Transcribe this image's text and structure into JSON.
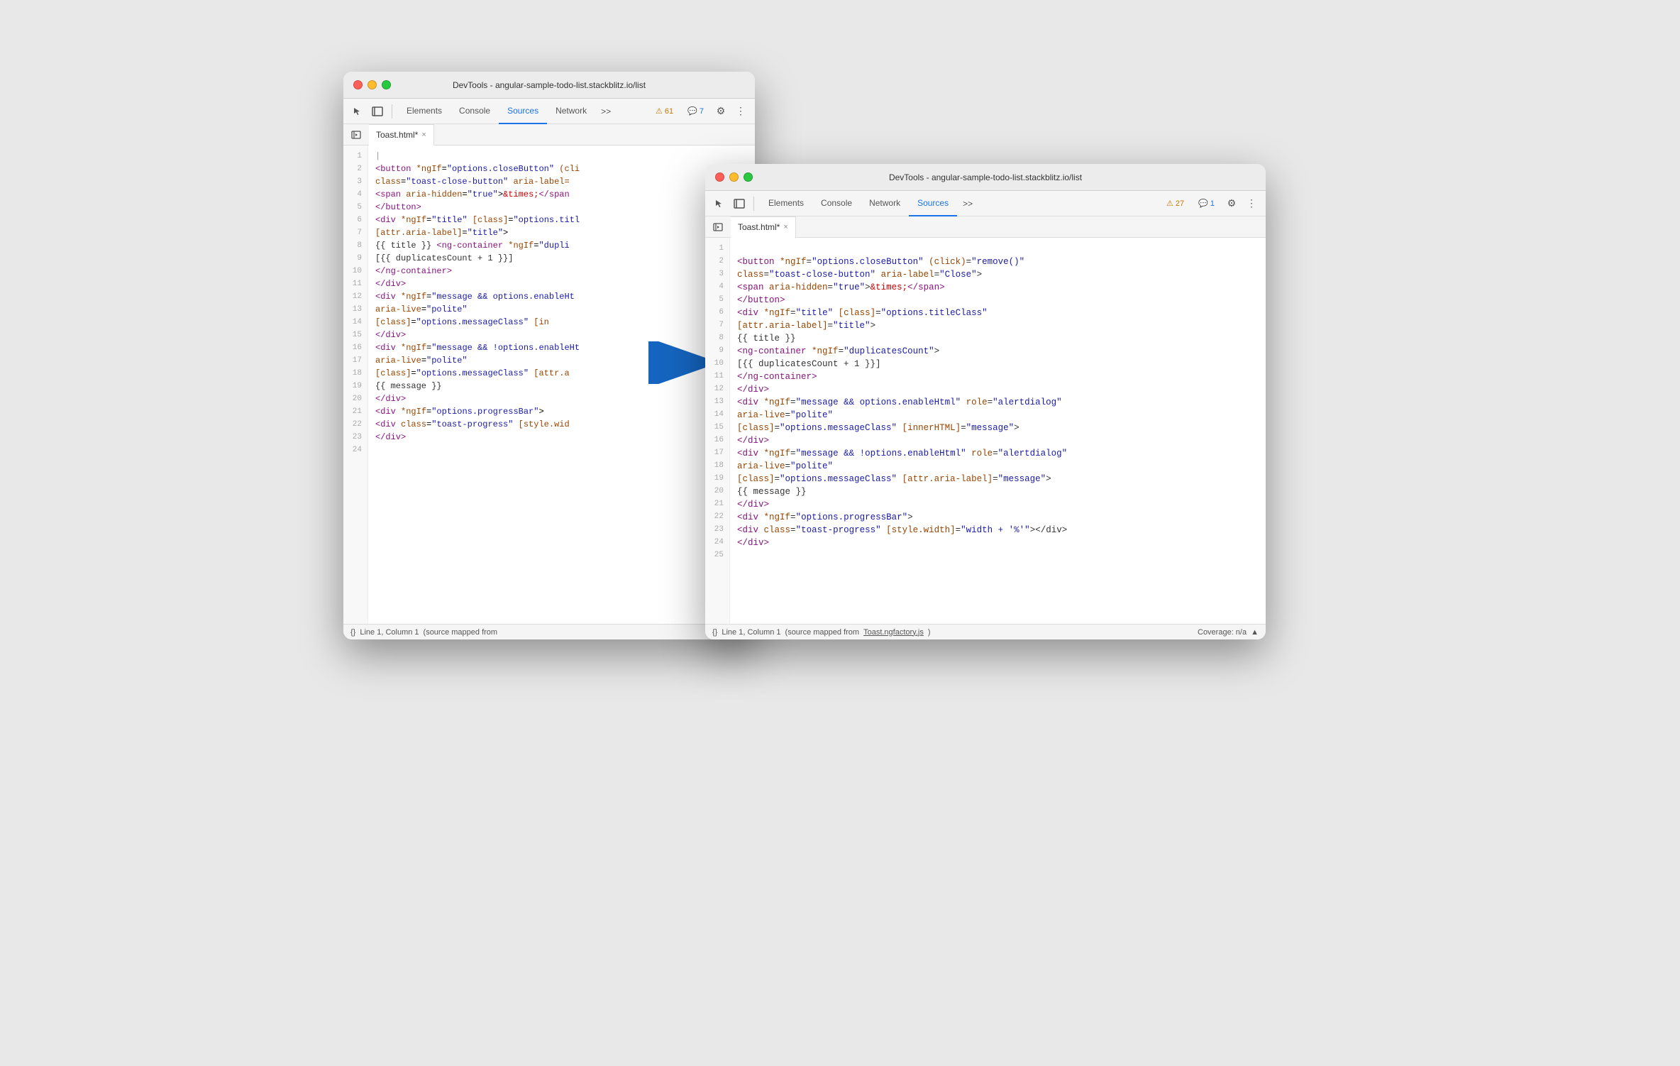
{
  "back_window": {
    "title": "DevTools - angular-sample-todo-list.stackblitz.io/list",
    "tabs": {
      "elements": "Elements",
      "console": "Console",
      "sources": "Sources",
      "network": "Network",
      "more": ">>"
    },
    "badges": {
      "warning_icon": "⚠",
      "warning_count": "61",
      "comment_icon": "💬",
      "comment_count": "7"
    },
    "file_tab": {
      "name": "Toast.html*",
      "close": "×"
    },
    "lines": [
      {
        "num": 1,
        "content": [
          {
            "t": " ",
            "c": ""
          }
        ]
      },
      {
        "num": 2,
        "content": [
          {
            "t": "  <button *ngIf=\"options.closeButton\" (cli",
            "c": "c-tag"
          }
        ]
      },
      {
        "num": 3,
        "content": [
          {
            "t": "      class=\"toast-close-button\" aria-label=",
            "c": "c-attr"
          }
        ]
      },
      {
        "num": 4,
        "content": [
          {
            "t": "    <span aria-hidden=\"true\">&times;</span>",
            "c": ""
          }
        ]
      },
      {
        "num": 5,
        "content": [
          {
            "t": "  </button>",
            "c": "c-tag"
          }
        ]
      },
      {
        "num": 6,
        "content": [
          {
            "t": "  <div *ngIf=\"title\" [class]=\"options.titl",
            "c": ""
          }
        ]
      },
      {
        "num": 7,
        "content": [
          {
            "t": "    [attr.aria-label]=\"title\">",
            "c": ""
          }
        ]
      },
      {
        "num": 8,
        "content": [
          {
            "t": "    {{ title }} <ng-container *ngIf=\"dupli",
            "c": ""
          }
        ]
      },
      {
        "num": 9,
        "content": [
          {
            "t": "      [{{ duplicatesCount + 1 }}]",
            "c": ""
          }
        ]
      },
      {
        "num": 10,
        "content": [
          {
            "t": "    </ng-container>",
            "c": "c-tag"
          }
        ]
      },
      {
        "num": 11,
        "content": [
          {
            "t": "  </div>",
            "c": "c-tag"
          }
        ]
      },
      {
        "num": 12,
        "content": [
          {
            "t": "  <div *ngIf=\"message && options.enableHt",
            "c": ""
          }
        ]
      },
      {
        "num": 13,
        "content": [
          {
            "t": "    aria-live=\"polite\"",
            "c": ""
          }
        ]
      },
      {
        "num": 14,
        "content": [
          {
            "t": "    [class]=\"options.messageClass\" [in",
            "c": ""
          }
        ]
      },
      {
        "num": 15,
        "content": [
          {
            "t": "  </div>",
            "c": "c-tag"
          }
        ]
      },
      {
        "num": 16,
        "content": [
          {
            "t": "  <div *ngIf=\"message && !options.enableHt",
            "c": ""
          }
        ]
      },
      {
        "num": 17,
        "content": [
          {
            "t": "    aria-live=\"polite\"",
            "c": ""
          }
        ]
      },
      {
        "num": 18,
        "content": [
          {
            "t": "    [class]=\"options.messageClass\" [attr.a",
            "c": ""
          }
        ]
      },
      {
        "num": 19,
        "content": [
          {
            "t": "    {{ message }}",
            "c": ""
          }
        ]
      },
      {
        "num": 20,
        "content": [
          {
            "t": "  </div>",
            "c": "c-tag"
          }
        ]
      },
      {
        "num": 21,
        "content": [
          {
            "t": "  <div *ngIf=\"options.progressBar\">",
            "c": ""
          }
        ]
      },
      {
        "num": 22,
        "content": [
          {
            "t": "    <div class=\"toast-progress\" [style.wid",
            "c": ""
          }
        ]
      },
      {
        "num": 23,
        "content": [
          {
            "t": "  </div>",
            "c": "c-tag"
          }
        ]
      },
      {
        "num": 24,
        "content": [
          {
            "t": "",
            "c": ""
          }
        ]
      }
    ],
    "status": {
      "left": "{}",
      "position": "Line 1, Column 1",
      "source": "(source mapped from "
    }
  },
  "front_window": {
    "title": "DevTools - angular-sample-todo-list.stackblitz.io/list",
    "tabs": {
      "elements": "Elements",
      "console": "Console",
      "network": "Network",
      "sources": "Sources",
      "more": ">>"
    },
    "badges": {
      "warning_icon": "⚠",
      "warning_count": "27",
      "comment_icon": "💬",
      "comment_count": "1"
    },
    "file_tab": {
      "name": "Toast.html*",
      "close": "×"
    },
    "lines": [
      {
        "num": 1,
        "html": ""
      },
      {
        "num": 2,
        "html": "<span class='c-tag'>&lt;button</span> <span class='c-brown'>*ngIf</span><span class='c-punct'>=</span><span class='c-str'>\"options.closeButton\"</span> <span class='c-brown'>(click)</span><span class='c-punct'>=</span><span class='c-str'>\"remove()\"</span>"
      },
      {
        "num": 3,
        "html": "<span class='c-brown'>    class</span><span class='c-punct'>=</span><span class='c-str'>\"toast-close-button\"</span> <span class='c-brown'>aria-label</span><span class='c-punct'>=</span><span class='c-str'>\"Close\"</span><span class='c-punct'>&gt;</span>"
      },
      {
        "num": 4,
        "html": "<span class='c-tag'>    &lt;span</span> <span class='c-brown'>aria-hidden</span><span class='c-punct'>=</span><span class='c-str'>\"true\"</span><span class='c-punct'>&gt;</span><span class='c-red'>&amp;times;</span><span class='c-tag'>&lt;/span&gt;</span>"
      },
      {
        "num": 5,
        "html": "<span class='c-tag'>  &lt;/button&gt;</span>"
      },
      {
        "num": 6,
        "html": "<span class='c-tag'>  &lt;div</span> <span class='c-brown'>*ngIf</span><span class='c-punct'>=</span><span class='c-str'>\"title\"</span> <span class='c-brown'>[class]</span><span class='c-punct'>=</span><span class='c-str'>\"options.titleClass\"</span>"
      },
      {
        "num": 7,
        "html": "<span class='c-brown'>    [attr.aria-label]</span><span class='c-punct'>=</span><span class='c-str'>\"title\"</span><span class='c-punct'>&gt;</span>"
      },
      {
        "num": 8,
        "html": "<span class='c-expr'>    {{ title }}</span>"
      },
      {
        "num": 9,
        "html": "<span class='c-tag'>    &lt;ng-container</span> <span class='c-brown'>*ngIf</span><span class='c-punct'>=</span><span class='c-str'>\"duplicatesCount\"</span><span class='c-punct'>&gt;</span>"
      },
      {
        "num": 10,
        "html": "<span class='c-expr'>      [{{ duplicatesCount + 1 }}]</span>"
      },
      {
        "num": 11,
        "html": "<span class='c-tag'>    &lt;/ng-container&gt;</span>"
      },
      {
        "num": 12,
        "html": "<span class='c-tag'>  &lt;/div&gt;</span>"
      },
      {
        "num": 13,
        "html": "<span class='c-tag'>  &lt;div</span> <span class='c-brown'>*ngIf</span><span class='c-punct'>=</span><span class='c-str'>\"message &amp;&amp; options.enableHtml\"</span> <span class='c-brown'>role</span><span class='c-punct'>=</span><span class='c-str'>\"alertdialog\"</span>"
      },
      {
        "num": 14,
        "html": "<span class='c-brown'>    aria-live</span><span class='c-punct'>=</span><span class='c-str'>\"polite\"</span>"
      },
      {
        "num": 15,
        "html": "<span class='c-brown'>    [class]</span><span class='c-punct'>=</span><span class='c-str'>\"options.messageClass\"</span> <span class='c-brown'>[innerHTML]</span><span class='c-punct'>=</span><span class='c-str'>\"message\"</span><span class='c-punct'>&gt;</span>"
      },
      {
        "num": 16,
        "html": "<span class='c-tag'>  &lt;/div&gt;</span>"
      },
      {
        "num": 17,
        "html": "<span class='c-tag'>  &lt;div</span> <span class='c-brown'>*ngIf</span><span class='c-punct'>=</span><span class='c-str'>\"message &amp;&amp; !options.enableHtml\"</span> <span class='c-brown'>role</span><span class='c-punct'>=</span><span class='c-str'>\"alertdialog\"</span>"
      },
      {
        "num": 18,
        "html": "<span class='c-brown'>    aria-live</span><span class='c-punct'>=</span><span class='c-str'>\"polite\"</span>"
      },
      {
        "num": 19,
        "html": "<span class='c-brown'>    [class]</span><span class='c-punct'>=</span><span class='c-str'>\"options.messageClass\"</span> <span class='c-brown'>[attr.aria-label]</span><span class='c-punct'>=</span><span class='c-str'>\"message\"</span><span class='c-punct'>&gt;</span>"
      },
      {
        "num": 20,
        "html": "<span class='c-expr'>    {{ message }}</span>"
      },
      {
        "num": 21,
        "html": "<span class='c-tag'>  &lt;/div&gt;</span>"
      },
      {
        "num": 22,
        "html": "<span class='c-tag'>  &lt;div</span> <span class='c-brown'>*ngIf</span><span class='c-punct'>=</span><span class='c-str'>\"options.progressBar\"</span><span class='c-punct'>&gt;</span>"
      },
      {
        "num": 23,
        "html": "<span class='c-tag'>    &lt;div</span> <span class='c-brown'>class</span><span class='c-punct'>=</span><span class='c-str'>\"toast-progress\"</span> <span class='c-brown'>[style.width]</span><span class='c-punct'>=</span><span class='c-str'>\"width + '%'\"</span><span class='c-punct'>&gt;&lt;/div&gt;</span>"
      },
      {
        "num": 24,
        "html": "<span class='c-tag'>  &lt;/div&gt;</span>"
      },
      {
        "num": 25,
        "html": ""
      }
    ],
    "status": {
      "left": "{}",
      "position": "Line 1, Column 1",
      "source": "(source mapped from ",
      "source_link": "Toast.ngfactory.js",
      "coverage": "Coverage: n/a"
    }
  },
  "arrow": {
    "color": "#1565c0"
  }
}
